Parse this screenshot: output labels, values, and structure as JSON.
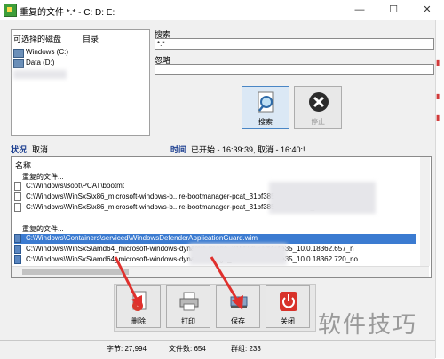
{
  "window": {
    "title": "重复的文件 *.* - C: D: E:",
    "minimize": "—",
    "maximize": "☐",
    "close": "✕"
  },
  "drives": {
    "col_drive": "可选择的磁盘",
    "col_dir": "目录",
    "items": [
      "Windows (C:)",
      "Data (D:)"
    ]
  },
  "search": {
    "label": "搜索",
    "value": "*.*",
    "ignore_label": "忽略",
    "ignore_value": ""
  },
  "buttons": {
    "search": "搜索",
    "stop": "停止",
    "delete": "删除",
    "print": "打印",
    "save": "保存",
    "close": "关闭"
  },
  "status": {
    "key": "状况",
    "value": "取消..",
    "time_key": "时间",
    "time_value": "已开始 - 16:39:39, 取消 - 16:40:!"
  },
  "results": {
    "col_name": "名称",
    "group_label": "重复的文件...",
    "group1": [
      "C:\\Windows\\Boot\\PCAT\\bootmt",
      "C:\\Windows\\WinSxS\\x86_microsoft-windows-b...re-bootmanager-pcat_31bf3856ad",
      "C:\\Windows\\WinSxS\\x86_microsoft-windows-b...re-bootmanager-pcat_31bf3856ad364e35_10.0"
    ],
    "group2": [
      "C:\\Windows\\Containers\\serviced\\WindowsDefenderApplicationGuard.wim",
      "C:\\Windows\\WinSxS\\amd64_microsoft-windows-dynamic-image_31bf3856ad364e35_10.0.18362.657_n",
      "C:\\Windows\\WinSxS\\amd64_microsoft-windows-dynamic-image_31bf3856ad364e35_10.0.18362.720_no"
    ]
  },
  "statusbar": {
    "bytes": "字节: 27,994",
    "files": "文件数: 654",
    "groups": "群组: 233"
  },
  "watermark": "软件技巧",
  "colors": {
    "selection": "#3b7bd1",
    "accent_label": "#1a3d8f",
    "arrow": "#e0302d"
  }
}
